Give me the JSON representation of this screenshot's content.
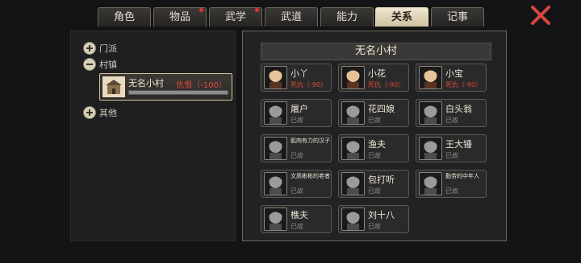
{
  "tabs": [
    {
      "label": "角色",
      "active": false,
      "badge": false
    },
    {
      "label": "物品",
      "active": false,
      "badge": true
    },
    {
      "label": "武学",
      "active": false,
      "badge": true
    },
    {
      "label": "武道",
      "active": false,
      "badge": false
    },
    {
      "label": "能力",
      "active": false,
      "badge": false
    },
    {
      "label": "关系",
      "active": true,
      "badge": false
    },
    {
      "label": "记事",
      "active": false,
      "badge": false
    }
  ],
  "tree": {
    "sect": "门派",
    "village_group": "村镇",
    "other": "其他",
    "selected": {
      "name": "无名小村",
      "status": "仇恨（-100）",
      "relation_value": -100
    }
  },
  "village": {
    "title": "无名小村",
    "members": [
      {
        "name": "小丫",
        "status": "死仇（-90）",
        "hostile": true
      },
      {
        "name": "小花",
        "status": "死仇（-90）",
        "hostile": true
      },
      {
        "name": "小宝",
        "status": "死仇（-90）",
        "hostile": true
      },
      {
        "name": "屠户",
        "status": "已故",
        "hostile": false
      },
      {
        "name": "花四娘",
        "status": "已故",
        "hostile": false
      },
      {
        "name": "白头翁",
        "status": "已故",
        "hostile": false
      },
      {
        "name": "肌肉有力的汉子",
        "status": "已故",
        "hostile": false,
        "small": true
      },
      {
        "name": "渔夫",
        "status": "已故",
        "hostile": false
      },
      {
        "name": "王大锤",
        "status": "已故",
        "hostile": false
      },
      {
        "name": "文质彬彬的老者",
        "status": "已故",
        "hostile": false,
        "small": true
      },
      {
        "name": "包打听",
        "status": "已故",
        "hostile": false
      },
      {
        "name": "勤劳的中年人",
        "status": "已故",
        "hostile": false,
        "small": true
      },
      {
        "name": "樵夫",
        "status": "已故",
        "hostile": false
      },
      {
        "name": "刘十八",
        "status": "已故",
        "hostile": false
      }
    ]
  },
  "colors": {
    "hostile": "#e04a3c",
    "deceased": "#8d8a83",
    "active_tab": "#efe6cf",
    "close": "#d9473d"
  },
  "icons": {
    "close": "close-x-icon",
    "expand": "plus-icon",
    "collapse": "minus-icon",
    "village": "house-icon"
  }
}
